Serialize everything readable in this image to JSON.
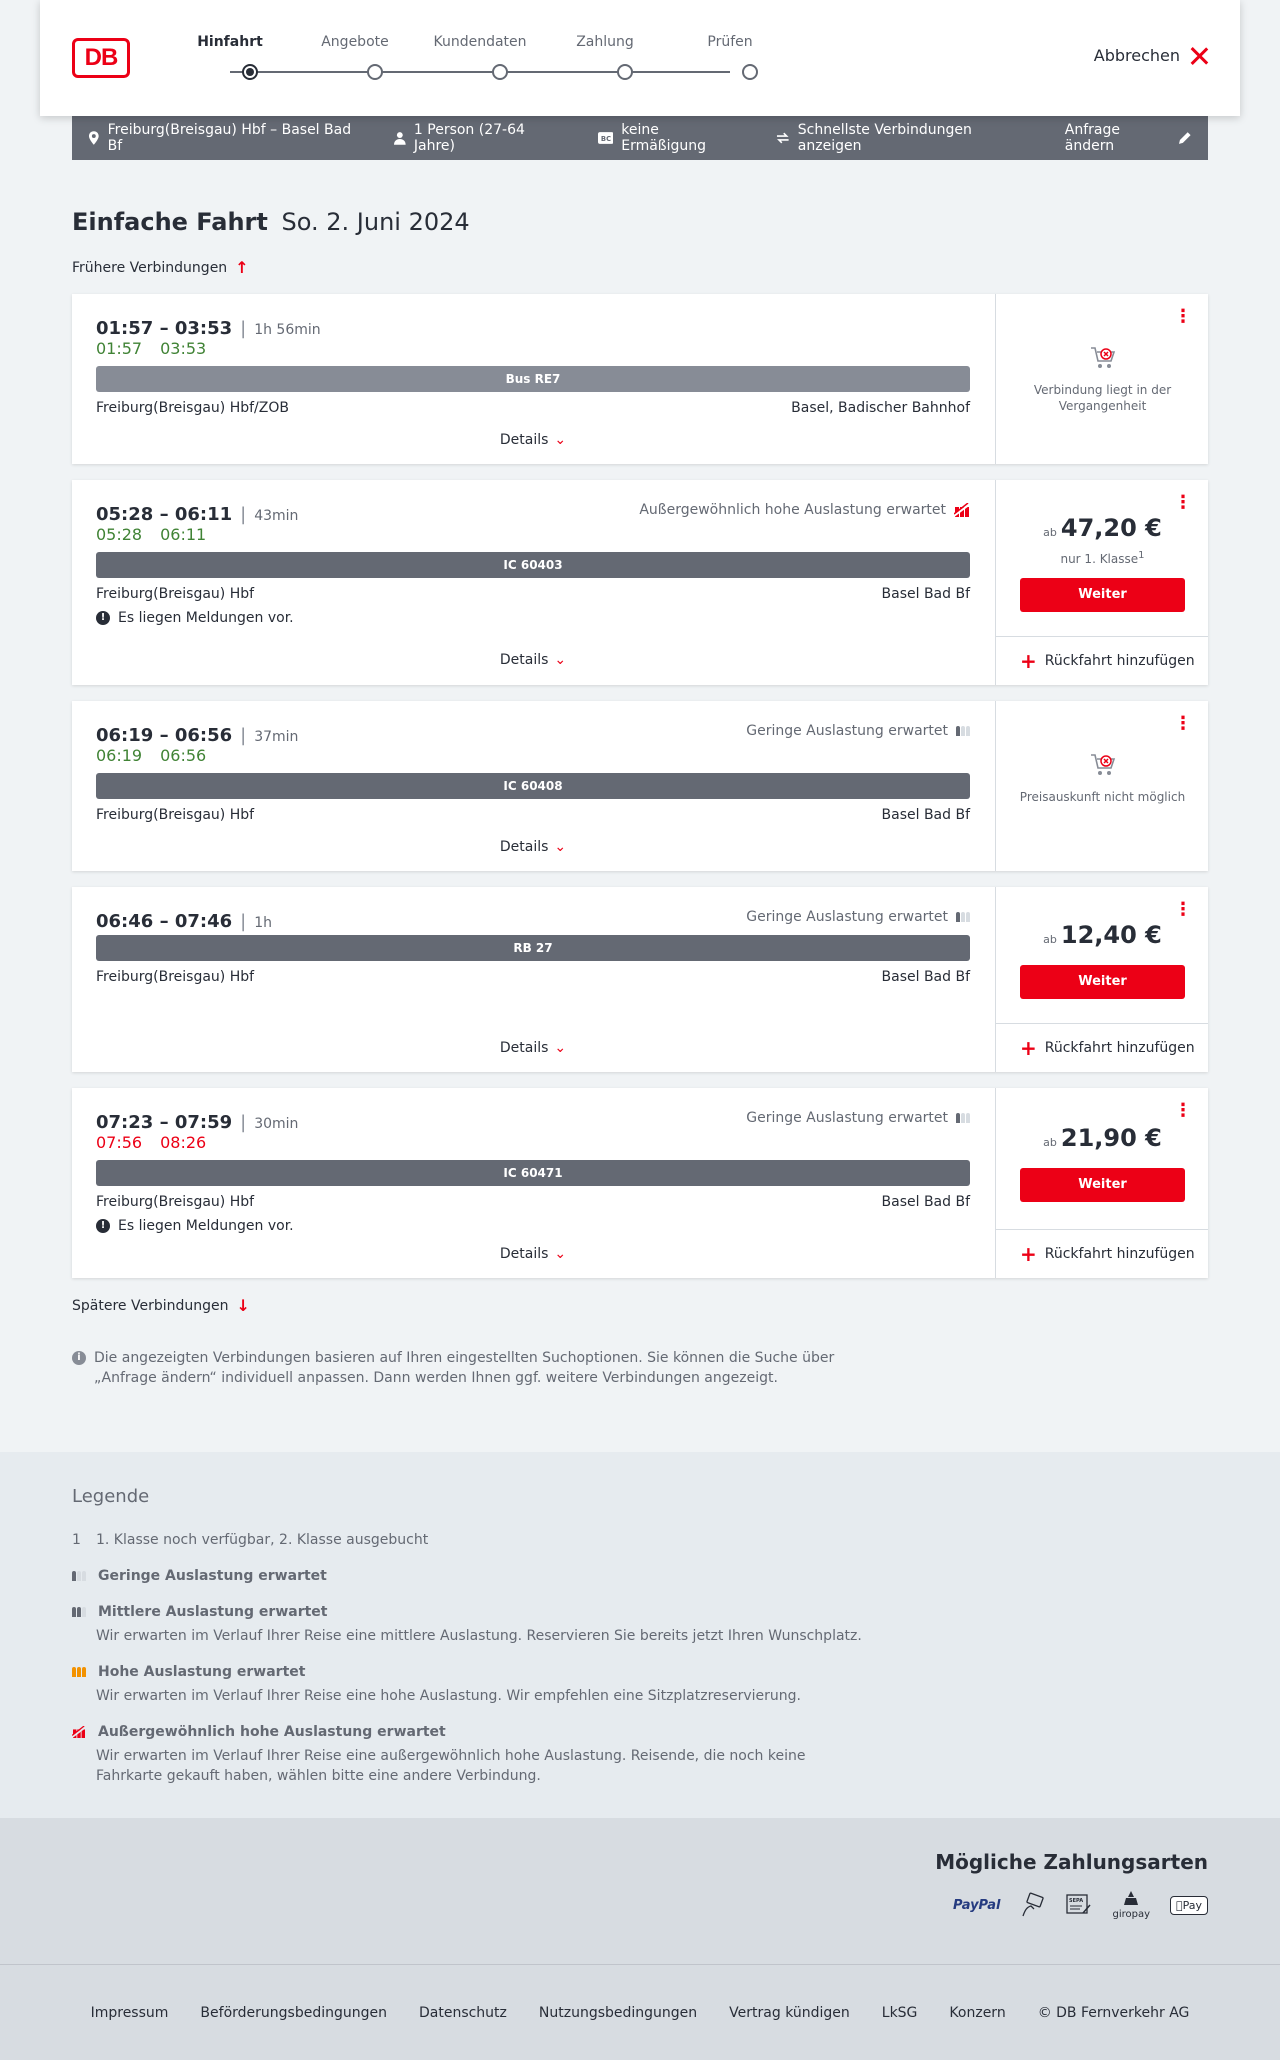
{
  "header": {
    "logo": "DB",
    "steps": [
      "Hinfahrt",
      "Angebote",
      "Kundendaten",
      "Zahlung",
      "Prüfen"
    ],
    "active_step": 0,
    "cancel_label": "Abbrechen"
  },
  "search_bar": {
    "route": "Freiburg(Breisgau) Hbf – Basel Bad Bf",
    "travellers": "1 Person (27-64 Jahre)",
    "discount": "keine Ermäßigung",
    "fastest": "Schnellste Verbindungen anzeigen",
    "change": "Anfrage ändern"
  },
  "page": {
    "title_bold": "Einfache Fahrt",
    "title_date": "So. 2. Juni 2024",
    "earlier": "Frühere Verbindungen",
    "later": "Spätere Verbindungen",
    "details": "Details",
    "add_return": "Rückfahrt hinzufügen",
    "continue": "Weiter",
    "price_prefix": "ab",
    "info": "Die angezeigten Verbindungen basieren auf Ihren eingestellten Suchoptionen. Sie können die Suche über „Anfrage ändern“ individuell anpassen. Dann werden Ihnen ggf. weitere Verbindungen angezeigt."
  },
  "connections": [
    {
      "time": "01:57 – 03:53",
      "duration": "1h 56min",
      "rt_dep": "01:57",
      "rt_arr": "03:53",
      "rt_color": "green",
      "train": "Bus RE7",
      "from": "Freiburg(Breisgau) Hbf/ZOB",
      "to": "Basel, Badischer Bahnhof",
      "unavailable": "Verbindung liegt in der Vergangenheit"
    },
    {
      "time": "05:28 – 06:11",
      "duration": "43min",
      "rt_dep": "05:28",
      "rt_arr": "06:11",
      "rt_color": "green",
      "occupancy": "Außergewöhnlich hohe Auslastung erwartet",
      "train": "IC 60403",
      "from": "Freiburg(Breisgau) Hbf",
      "to": "Basel Bad Bf",
      "message": "Es liegen Meldungen vor.",
      "price": "47,20 €",
      "class_note": "nur 1. Klasse",
      "class_note_sup": "1"
    },
    {
      "time": "06:19 – 06:56",
      "duration": "37min",
      "rt_dep": "06:19",
      "rt_arr": "06:56",
      "rt_color": "green",
      "occupancy": "Geringe Auslastung erwartet",
      "train": "IC 60408",
      "from": "Freiburg(Breisgau) Hbf",
      "to": "Basel Bad Bf",
      "unavailable": "Preisauskunft nicht möglich"
    },
    {
      "time": "06:46 – 07:46",
      "duration": "1h",
      "occupancy": "Geringe Auslastung erwartet",
      "train": "RB 27",
      "from": "Freiburg(Breisgau) Hbf",
      "to": "Basel Bad Bf",
      "price": "12,40 €"
    },
    {
      "time": "07:23 – 07:59",
      "duration": "30min",
      "rt_dep": "07:56",
      "rt_arr": "08:26",
      "rt_color": "red",
      "occupancy": "Geringe Auslastung erwartet",
      "train": "IC 60471",
      "from": "Freiburg(Breisgau) Hbf",
      "to": "Basel Bad Bf",
      "message": "Es liegen Meldungen vor.",
      "price": "21,90 €"
    }
  ],
  "legend": {
    "title": "Legende",
    "items": [
      {
        "marker": "1",
        "head": "1. Klasse noch verfügbar, 2. Klasse ausgebucht"
      },
      {
        "head": "Geringe Auslastung erwartet"
      },
      {
        "head": "Mittlere Auslastung erwartet",
        "desc": "Wir erwarten im Verlauf Ihrer Reise eine mittlere Auslastung. Reservieren Sie bereits jetzt Ihren Wunschplatz."
      },
      {
        "head": "Hohe Auslastung erwartet",
        "desc": "Wir erwarten im Verlauf Ihrer Reise eine hohe Auslastung. Wir empfehlen eine Sitzplatzreservierung."
      },
      {
        "head": "Außergewöhnlich hohe Auslastung erwartet",
        "desc": "Wir erwarten im Verlauf Ihrer Reise eine außergewöhnlich hohe Auslastung. Reisende, die noch keine Fahrkarte gekauft haben, wählen bitte eine andere Verbindung."
      }
    ]
  },
  "payment": {
    "title": "Mögliche Zahlungsarten",
    "methods": [
      "PayPal",
      "SEPA",
      "giropay",
      "Pay"
    ]
  },
  "footer": [
    "Impressum",
    "Beförderungsbedingungen",
    "Datenschutz",
    "Nutzungsbedingungen",
    "Vertrag kündigen",
    "LkSG",
    "Konzern",
    "© DB Fernverkehr AG"
  ],
  "colors": {
    "brand": "#ec0016",
    "on_time": "#408335",
    "bar": "#646973"
  }
}
